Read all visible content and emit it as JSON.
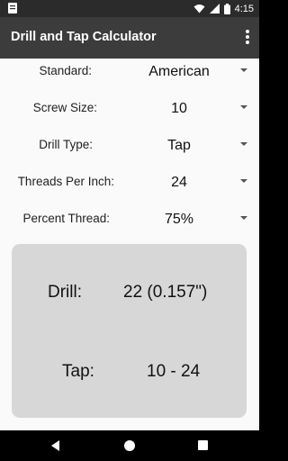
{
  "status_bar": {
    "time": "4:15",
    "icons": [
      "notification-icon",
      "wifi-icon",
      "signal-icon",
      "battery-icon"
    ]
  },
  "app_bar": {
    "title": "Drill and Tap Calculator",
    "menu_icon": "overflow-menu-icon"
  },
  "form": {
    "standard": {
      "label": "Standard:",
      "value": "American"
    },
    "screw_size": {
      "label": "Screw Size:",
      "value": "10"
    },
    "drill_type": {
      "label": "Drill Type:",
      "value": "Tap"
    },
    "threads_per_inch": {
      "label": "Threads Per Inch:",
      "value": "24"
    },
    "percent_thread": {
      "label": "Percent Thread:",
      "value": "75%"
    }
  },
  "result": {
    "drill_label": "Drill:",
    "drill_value": "22 (0.157\")",
    "tap_label": "Tap:",
    "tap_value": "10 - 24"
  },
  "colors": {
    "status_bar": "#2b2b2b",
    "app_bar": "#3c3c3c",
    "background": "#fafafa",
    "result_card": "#d7d7d7"
  },
  "nav_bar": {
    "icons": [
      "back-icon",
      "home-icon",
      "recents-icon"
    ]
  }
}
